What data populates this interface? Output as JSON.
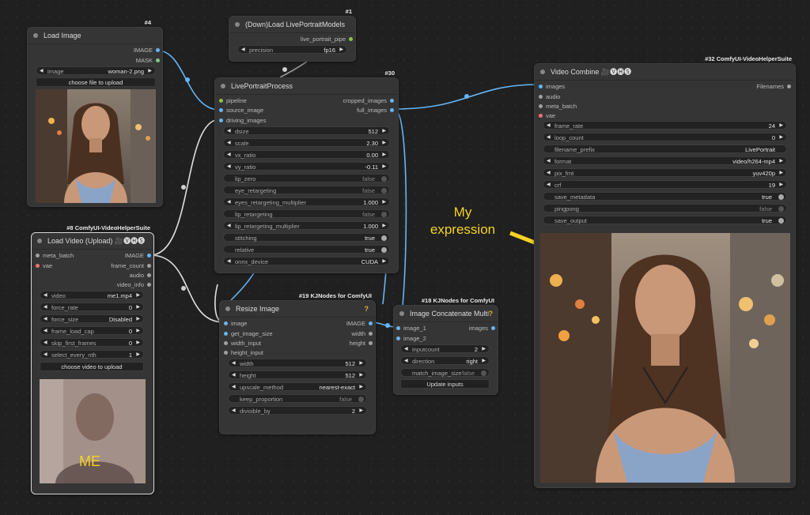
{
  "colors": {
    "image": "#64b5f6",
    "mask": "#81c784",
    "pipe": "#8bc34a",
    "vae": "#ff6e6e",
    "audio": "#a0a0a0",
    "latent": "#a0a0a0"
  },
  "nodes": {
    "load_image": {
      "id": "#4",
      "title": "Load Image",
      "outputs": [
        "IMAGE",
        "MASK"
      ],
      "image_label": "image",
      "image_value": "woman-2.png",
      "upload_button": "choose file to upload"
    },
    "load_models": {
      "id": "#1",
      "title": "(Down)Load LivePortraitModels",
      "output": "live_portrait_pipe",
      "precision_label": "precision",
      "precision_value": "fp16"
    },
    "process": {
      "id": "#30",
      "title": "LivePortraitProcess",
      "inputs": [
        "pipeline",
        "source_image",
        "driving_images"
      ],
      "outputs": [
        "cropped_images",
        "full_images"
      ],
      "widgets": [
        {
          "label": "dsize",
          "value": "512"
        },
        {
          "label": "scale",
          "value": "2.30"
        },
        {
          "label": "vx_ratio",
          "value": "0.00"
        },
        {
          "label": "vy_ratio",
          "value": "-0.11"
        },
        {
          "label": "lip_zero",
          "value": "false"
        },
        {
          "label": "eye_retargeting",
          "value": "false"
        },
        {
          "label": "eyes_retargeting_multiplier",
          "value": "1.000"
        },
        {
          "label": "lip_retargeting",
          "value": "false"
        },
        {
          "label": "lip_retargeting_multiplier",
          "value": "1.000"
        },
        {
          "label": "stitching",
          "value": "true"
        },
        {
          "label": "relative",
          "value": "true"
        },
        {
          "label": "onnx_device",
          "value": "CUDA"
        }
      ]
    },
    "video_combine": {
      "id": "#32 ComfyUI-VideoHelperSuite",
      "title": "Video Combine",
      "title_emoji": "🎥🅥🅗🅢",
      "inputs": [
        "images",
        "audio",
        "meta_batch",
        "vae"
      ],
      "output": "Filenames",
      "widgets": [
        {
          "label": "frame_rate",
          "value": "24"
        },
        {
          "label": "loop_count",
          "value": "0"
        },
        {
          "label": "filename_prefix",
          "value": "LivePortrait"
        },
        {
          "label": "format",
          "value": "video/h264-mp4"
        },
        {
          "label": "pix_fmt",
          "value": "yuv420p"
        },
        {
          "label": "crf",
          "value": "19"
        },
        {
          "label": "save_metadata",
          "value": "true"
        },
        {
          "label": "pingpong",
          "value": "false"
        },
        {
          "label": "save_output",
          "value": "true"
        }
      ]
    },
    "load_video": {
      "id": "#8 ComfyUI-VideoHelperSuite",
      "title": "Load Video (Upload)",
      "title_emoji": "🎥🅥🅗🅢",
      "inputs": [
        "meta_batch",
        "vae"
      ],
      "outputs": [
        "IMAGE",
        "frame_count",
        "audio",
        "video_info"
      ],
      "widgets": [
        {
          "label": "video",
          "value": "me1.mp4"
        },
        {
          "label": "force_rate",
          "value": "0"
        },
        {
          "label": "force_size",
          "value": "Disabled"
        },
        {
          "label": "frame_load_cap",
          "value": "0"
        },
        {
          "label": "skip_first_frames",
          "value": "0"
        },
        {
          "label": "select_every_nth",
          "value": "1"
        }
      ],
      "upload_button": "choose video to upload",
      "preview_caption": "ME"
    },
    "resize": {
      "id": "#19 KJNodes for ComfyUI",
      "title": "Resize Image",
      "inputs": [
        "image",
        "get_image_size",
        "width_input",
        "height_input"
      ],
      "outputs": [
        "IMAGE",
        "width",
        "height"
      ],
      "widgets": [
        {
          "label": "width",
          "value": "512"
        },
        {
          "label": "height",
          "value": "512"
        },
        {
          "label": "upscale_method",
          "value": "nearest-exact"
        },
        {
          "label": "keep_proportion",
          "value": "false"
        },
        {
          "label": "divisible_by",
          "value": "2"
        }
      ]
    },
    "concat": {
      "id": "#18 KJNodes for ComfyUI",
      "title": "Image Concatenate Multi",
      "inputs": [
        "image_1",
        "image_2"
      ],
      "output": "images",
      "widgets": [
        {
          "label": "inputcount",
          "value": "2"
        },
        {
          "label": "direction",
          "value": "right"
        },
        {
          "label": "match_image_size",
          "value": "false"
        }
      ],
      "update_button": "Update inputs"
    }
  },
  "annotation": {
    "line1": "My",
    "line2": "expression"
  }
}
